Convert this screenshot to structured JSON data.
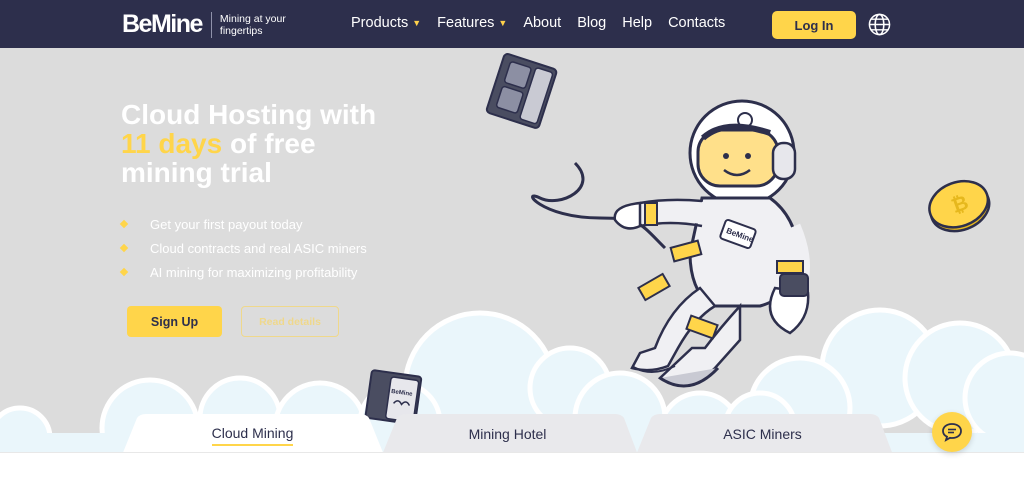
{
  "header": {
    "brand": "BeMine",
    "tagline": "Mining at your fingertips",
    "nav": [
      {
        "label": "Products",
        "dropdown": true
      },
      {
        "label": "Features",
        "dropdown": true
      },
      {
        "label": "About",
        "dropdown": false
      },
      {
        "label": "Blog",
        "dropdown": false
      },
      {
        "label": "Help",
        "dropdown": false
      },
      {
        "label": "Contacts",
        "dropdown": false
      }
    ],
    "login_label": "Log In",
    "language_icon": "globe-icon"
  },
  "hero": {
    "title_line1": "Cloud Hosting with",
    "title_accent": "11 days",
    "title_line2_rest": " of free",
    "title_line3": "mining trial",
    "features": [
      "Get your first payout today",
      "Cloud contracts and real ASIC miners",
      "AI mining for maximizing profitability"
    ],
    "signup_label": "Sign Up",
    "secondary_label": "Read details",
    "astronaut_badge": "BeMine",
    "miner_badge": "BeMine"
  },
  "tabs": [
    {
      "label": "Cloud Mining",
      "active": true
    },
    {
      "label": "Mining Hotel",
      "active": false
    },
    {
      "label": "ASIC Miners",
      "active": false
    }
  ],
  "chat_icon": "chat-bubble-icon",
  "colors": {
    "navy": "#2d2f4c",
    "accent": "#ffd54a",
    "hero_bg": "#dcdcdc",
    "cloud": "#eaf6fb"
  }
}
